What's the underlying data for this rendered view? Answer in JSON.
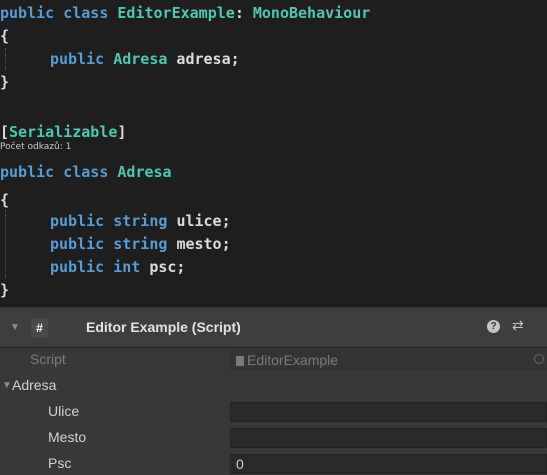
{
  "code": {
    "line1": {
      "kw": "public class ",
      "cls": "EditorExample",
      "sep": ": ",
      "base": "MonoBehaviour"
    },
    "line2": "{",
    "line3": {
      "kw": "public ",
      "cls": "Adresa",
      "id": " adresa;"
    },
    "line4": "}",
    "line5": {
      "open": "[",
      "attr": "Serializable",
      "close": "]"
    },
    "codelens": "Počet odkazů: 1",
    "line6": {
      "kw": "public class ",
      "cls": "Adresa"
    },
    "line7": "{",
    "line8": {
      "kw": "public string ",
      "id": "ulice;"
    },
    "line9": {
      "kw": "public string ",
      "id": "mesto;"
    },
    "line10": {
      "kw": "public int ",
      "id": "psc;"
    },
    "line11": "}"
  },
  "inspector": {
    "title": "Editor Example (Script)",
    "script_icon": "#",
    "help_icon": "?",
    "settings_icon": "⇄",
    "script_label": "Script",
    "script_value": "EditorExample",
    "adresa_label": "Adresa",
    "ulice_label": "Ulice",
    "ulice_value": "",
    "mesto_label": "Mesto",
    "mesto_value": "",
    "psc_label": "Psc",
    "psc_value": "0"
  }
}
